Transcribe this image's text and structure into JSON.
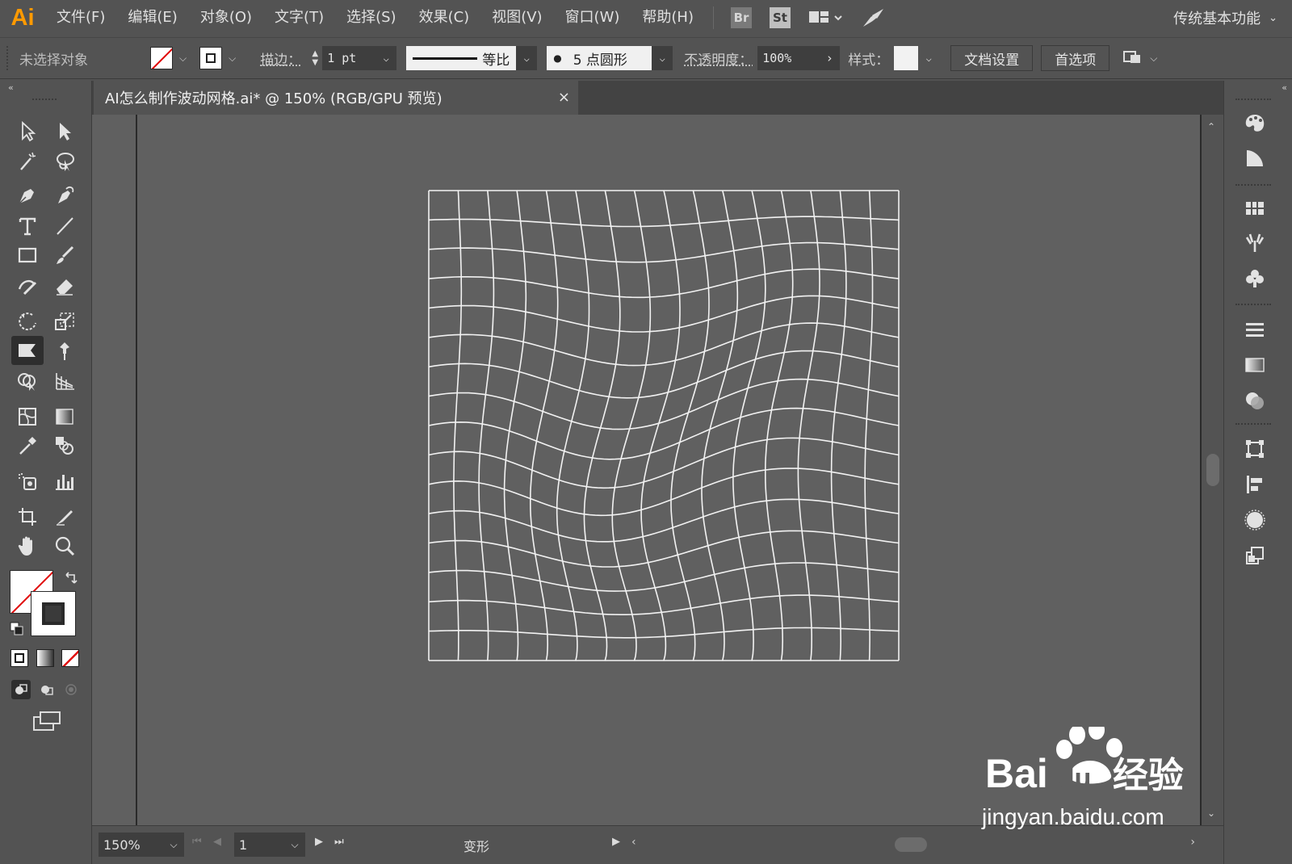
{
  "app": {
    "logo": "Ai",
    "workspace": "传统基本功能"
  },
  "menu": [
    "文件(F)",
    "编辑(E)",
    "对象(O)",
    "文字(T)",
    "选择(S)",
    "效果(C)",
    "视图(V)",
    "窗口(W)",
    "帮助(H)"
  ],
  "bridge": {
    "br": "Br",
    "st": "St"
  },
  "control": {
    "selection_status": "未选择对象",
    "stroke_label": "描边：",
    "stroke_value": "1 pt",
    "stroke_profile": "等比",
    "brush_value": "5 点圆形",
    "opacity_label": "不透明度：",
    "opacity_value": "100%",
    "style_label": "样式：",
    "doc_setup": "文档设置",
    "preferences": "首选项"
  },
  "document": {
    "tab_title": "AI怎么制作波动网格.ai* @ 150% (RGB/GPU 预览)",
    "close": "×"
  },
  "status": {
    "zoom": "150%",
    "page": "1",
    "mode": "变形"
  },
  "watermark": {
    "brand": "Bai",
    "brand2": "du",
    "cn": "经验",
    "url": "jingyan.baidu.com"
  },
  "colors": {
    "accent": "#ff9a00",
    "canvas": "#606060",
    "ui": "#535353"
  },
  "icons": {
    "left": [
      "selection-tool-icon",
      "direct-selection-tool-icon",
      "magic-wand-icon",
      "lasso-icon",
      "pen-tool-icon",
      "curvature-tool-icon",
      "type-tool-icon",
      "line-tool-icon",
      "rectangle-tool-icon",
      "paintbrush-icon",
      "shaper-tool-icon",
      "eraser-icon",
      "rotate-tool-icon",
      "scale-tool-icon",
      "warp-tool-icon",
      "puppet-warp-icon",
      "shape-builder-icon",
      "perspective-grid-icon",
      "mesh-tool-icon",
      "gradient-tool-icon",
      "eyedropper-icon",
      "blend-tool-icon",
      "symbol-sprayer-icon",
      "column-graph-icon",
      "artboard-tool-icon",
      "slice-tool-icon",
      "hand-tool-icon",
      "zoom-tool-icon"
    ],
    "right": [
      "color-palette-icon",
      "color-guide-icon",
      "swatches-icon",
      "brushes-icon",
      "symbols-icon",
      "stroke-icon",
      "gradient-icon",
      "transparency-icon",
      "transform-icon",
      "align-icon",
      "appearance-icon",
      "layers-icon"
    ]
  }
}
